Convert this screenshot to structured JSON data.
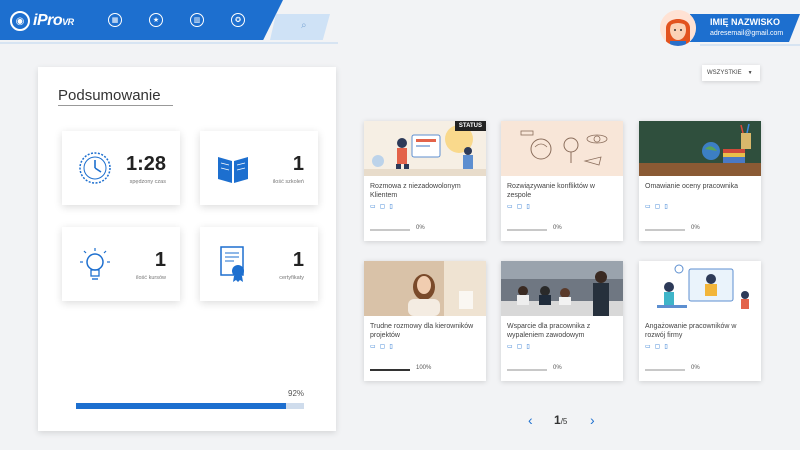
{
  "header": {
    "logo_main": "iPro",
    "logo_sub": "VR",
    "nav_icons": [
      "book-icon",
      "star-icon",
      "building-icon",
      "award-icon"
    ]
  },
  "user": {
    "name": "IMIĘ NAZWISKO",
    "email": "adresemail@gmail.com"
  },
  "summary": {
    "title": "Podsumowanie",
    "stats": [
      {
        "value": "1:28",
        "label": "spędzony czas",
        "icon": "clock-icon"
      },
      {
        "value": "1",
        "label": "ilość szkoleń",
        "icon": "book-icon"
      },
      {
        "value": "1",
        "label": "ilość kursów",
        "icon": "lightbulb-icon"
      },
      {
        "value": "1",
        "label": "certyfikaty",
        "icon": "certificate-icon"
      }
    ],
    "progress_label": "92%",
    "progress_value": 92
  },
  "filter": {
    "label": "WSZYSTKIE"
  },
  "courses": [
    {
      "title": "Rozmowa z niezadowolonym Klientem",
      "progress_label": "0%",
      "progress_value": 0,
      "status": "STATUS"
    },
    {
      "title": "Rozwiązywanie konfliktów w zespole",
      "progress_label": "0%",
      "progress_value": 0
    },
    {
      "title": "Omawianie oceny pracownika",
      "progress_label": "0%",
      "progress_value": 0
    },
    {
      "title": "Trudne rozmowy dla kierowników projektów",
      "progress_label": "100%",
      "progress_value": 100
    },
    {
      "title": "Wsparcie dla pracownika z wypaleniem zawodowym",
      "progress_label": "0%",
      "progress_value": 0
    },
    {
      "title": "Angażowanie pracowników w rozwój firmy",
      "progress_label": "0%",
      "progress_value": 0
    }
  ],
  "pagination": {
    "current": "1",
    "total": "/5"
  },
  "colors": {
    "accent": "#1d6fcf",
    "background": "#f2f3f5"
  }
}
